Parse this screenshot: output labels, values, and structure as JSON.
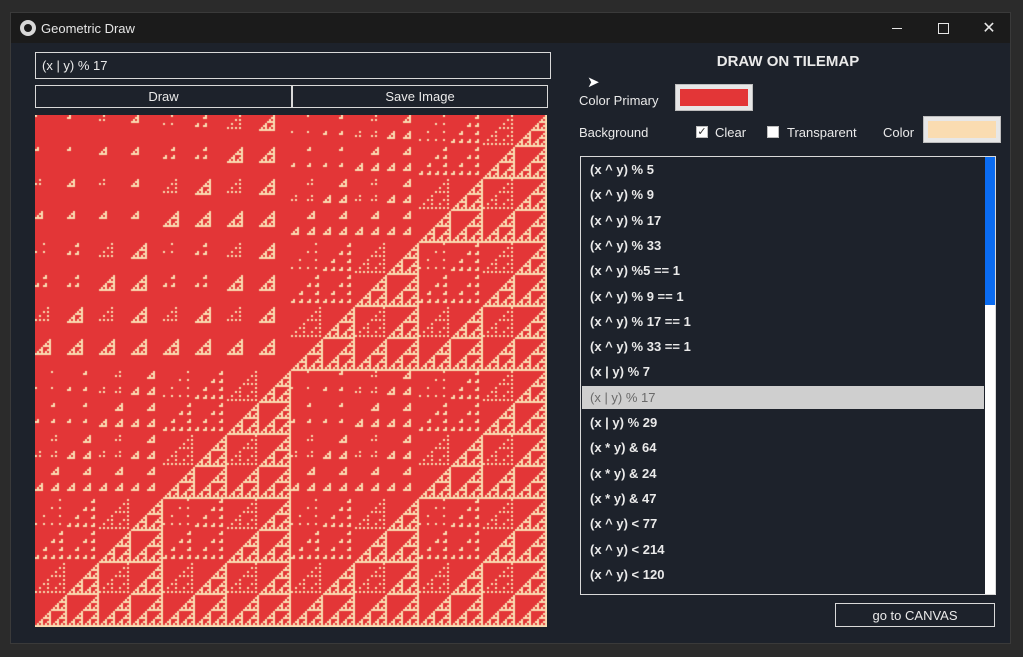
{
  "window": {
    "title": "Geometric Draw",
    "app_icon": "app-logo-icon",
    "controls": {
      "minimize_icon": "minimize-icon",
      "maximize_icon": "maximize-icon",
      "close_icon": "close-icon"
    }
  },
  "left": {
    "expression_value": "(x | y) % 17",
    "draw_label": "Draw",
    "save_label": "Save Image"
  },
  "canvas": {
    "expression": "(x | y) % 17",
    "primary_color": "#e33637",
    "background_color": "#fadcb1"
  },
  "right": {
    "heading": "DRAW ON TILEMAP",
    "color_primary_label": "Color Primary",
    "background_label": "Background",
    "clear_label": "Clear",
    "clear_checked": true,
    "transparent_label": "Transparent",
    "transparent_checked": false,
    "color_label": "Color",
    "goto_label": "go to CANVAS"
  },
  "colors": {
    "primary": "#e33637",
    "background": "#fadcb1",
    "scrollbar_accent": "#0a6cf2"
  },
  "list": {
    "selected_index": 9,
    "items": [
      "(x ^ y) % 5",
      "(x ^ y) % 9",
      "(x ^ y) % 17",
      "(x ^ y) % 33",
      "(x ^ y) %5 == 1",
      "(x ^ y) % 9 == 1",
      "(x ^ y) % 17 == 1",
      "(x ^ y) % 33 == 1",
      "(x | y) % 7",
      "(x | y) % 17",
      "(x | y) % 29",
      "(x * y) & 64",
      "(x * y) & 24",
      "(x * y) & 47",
      "(x ^ y) < 77",
      "(x ^ y) < 214",
      "(x ^ y) < 120"
    ]
  }
}
